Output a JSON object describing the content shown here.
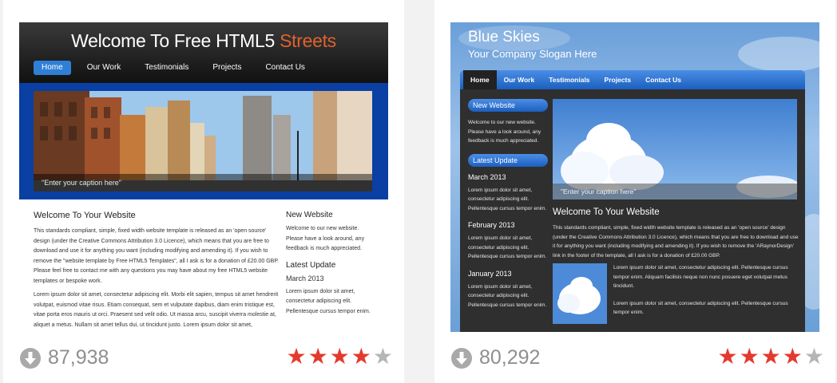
{
  "colors": {
    "star_filled": "#e33a2d",
    "star_empty": "#b5b5b5",
    "accent_orange": "#e0622c",
    "nav_blue": "#2f7fd6"
  },
  "cards": [
    {
      "template": {
        "title_main": "Welcome To Free HTML5 ",
        "title_accent": "Streets",
        "nav": [
          "Home",
          "Our Work",
          "Testimonials",
          "Projects",
          "Contact Us"
        ],
        "caption": "\"Enter your caption here\"",
        "main_heading": "Welcome To Your Website",
        "main_p1": "This standards compliant, simple, fixed width website template is released as an 'open source' design (under the Creative Commons Attribution 3.0 Licence), which means that you are free to download and use it for anything you want (including modifying and amending it). If you wish to remove the \"website template by Free HTML5 Templates\", all I ask is for a donation of £20.00 GBP. Please feel free to contact me with any questions you may have about my free HTML5 website templates or bespoke work.",
        "main_p2": "Lorem ipsum dolor sit amet, consectetur adipiscing elit. Morbi elit sapien, tempus sit amet hendrerit volutpat, euismod vitae risus. Etiam consequat, sem et vulputate dapibus, diam enim tristique est, vitae porta eros mauris ut orci. Praesent sed velit odio. Ut massa arcu, suscipit viverra molestie at, aliquet a metus. Nullam sit amet tellus dui, ut tincidunt justo. Lorem ipsum dolor sit amet, consectetur adipiscing elit. Donec iaculis egestas laoreet. Nunc non ipsum metus, non laoreet urna. Vestibulum quis risus quis",
        "side_h1": "New Website",
        "side_p1": "Welcome to our new website. Please have a look around, any feedback is much appreciated.",
        "side_h2": "Latest Update",
        "side_date": "March 2013",
        "side_p2": "Lorem ipsum dolor sit amet, consectetur adipiscing elit. Pellentesque cursus tempor enim."
      },
      "downloads": "87,938",
      "rating": 4
    },
    {
      "template": {
        "title": "Blue Skies",
        "slogan": "Your Company Slogan Here",
        "nav": [
          "Home",
          "Our Work",
          "Testimonials",
          "Projects",
          "Contact Us"
        ],
        "side_h1": "New Website",
        "side_p1": "Welcome to our new website. Please have a look around, any feedback is much appreciated.",
        "side_h2": "Latest Update",
        "updates": [
          {
            "date": "March 2013",
            "text": "Lorem ipsum dolor sit amet, consectetur adipiscing elit. Pellentesque cursus tempor enim."
          },
          {
            "date": "February 2013",
            "text": "Lorem ipsum dolor sit amet, consectetur adipiscing elit. Pellentesque cursus tempor enim."
          },
          {
            "date": "January 2013",
            "text": "Lorem ipsum dolor sit amet, consectetur adipiscing elit. Pellentesque cursus tempor enim."
          }
        ],
        "caption": "\"Enter your caption here\"",
        "main_heading": "Welcome To Your Website",
        "main_p1": "This standards compliant, simple, fixed width website template is released as an 'open source' design (under the Creative Commons Attribution 3.0 Licence), which means that you are free to download and use it for anything you want (including modifying and amending it). If you wish to remove the 'ARaynorDesign' link in the footer of the template, all I ask is for a donation of £20.00 GBP.",
        "aside_p1": "Lorem ipsum dolor sit amet, consectetur adipiscing elit. Pellentesque cursus tempor enim. Aliquam facilisis neque non nunc posuere eget volutpat metus tincidunt.",
        "aside_p2": "Lorem ipsum dolor sit amet, consectetur adipiscing elit. Pellentesque cursus tempor enim."
      },
      "downloads": "80,292",
      "rating": 4
    }
  ]
}
